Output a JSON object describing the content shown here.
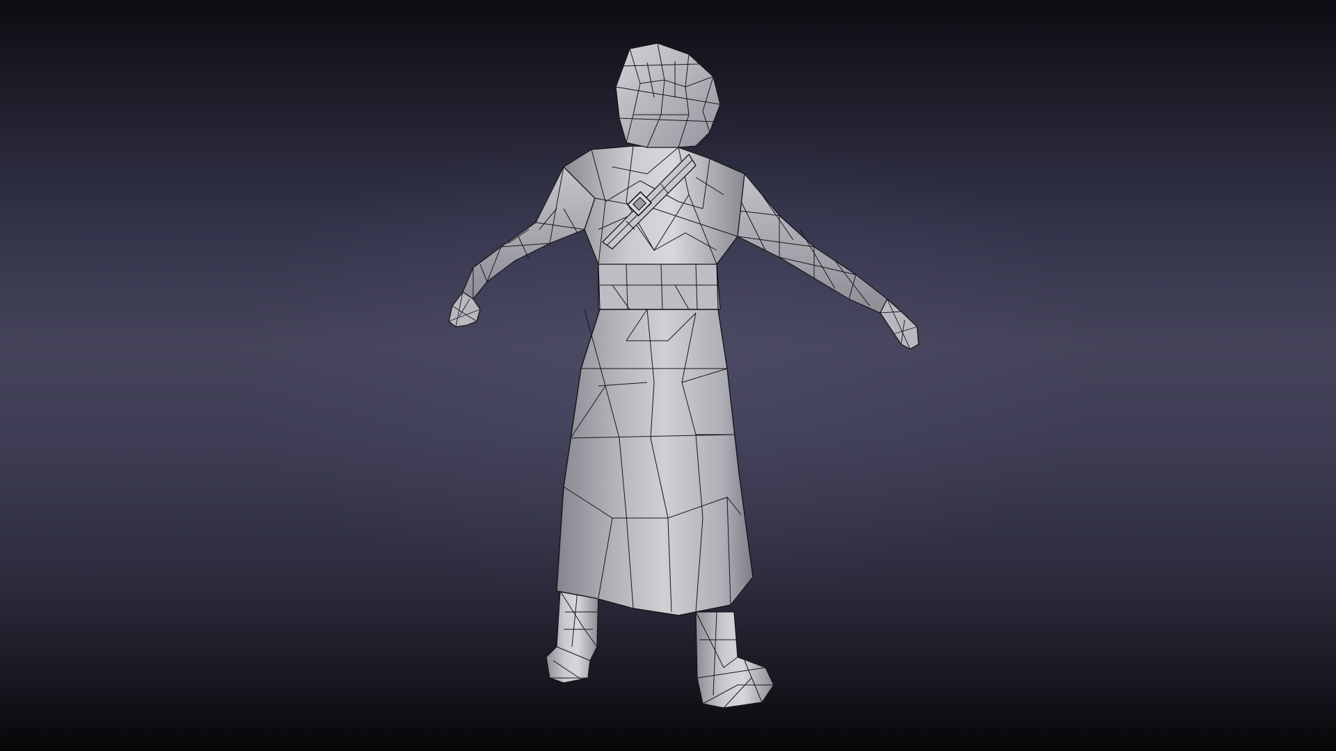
{
  "scene": {
    "subject": "character-model",
    "view": "back",
    "render_style": "wireframe-on-shaded",
    "colors": {
      "background_top": "#0c0c12",
      "background_mid": "#44435a",
      "background_bottom": "#060608",
      "model_fill_light": "#d4d4d8",
      "model_fill_mid": "#a8a8ae",
      "model_fill_dark": "#6f6f78",
      "wire": "#141418"
    }
  }
}
